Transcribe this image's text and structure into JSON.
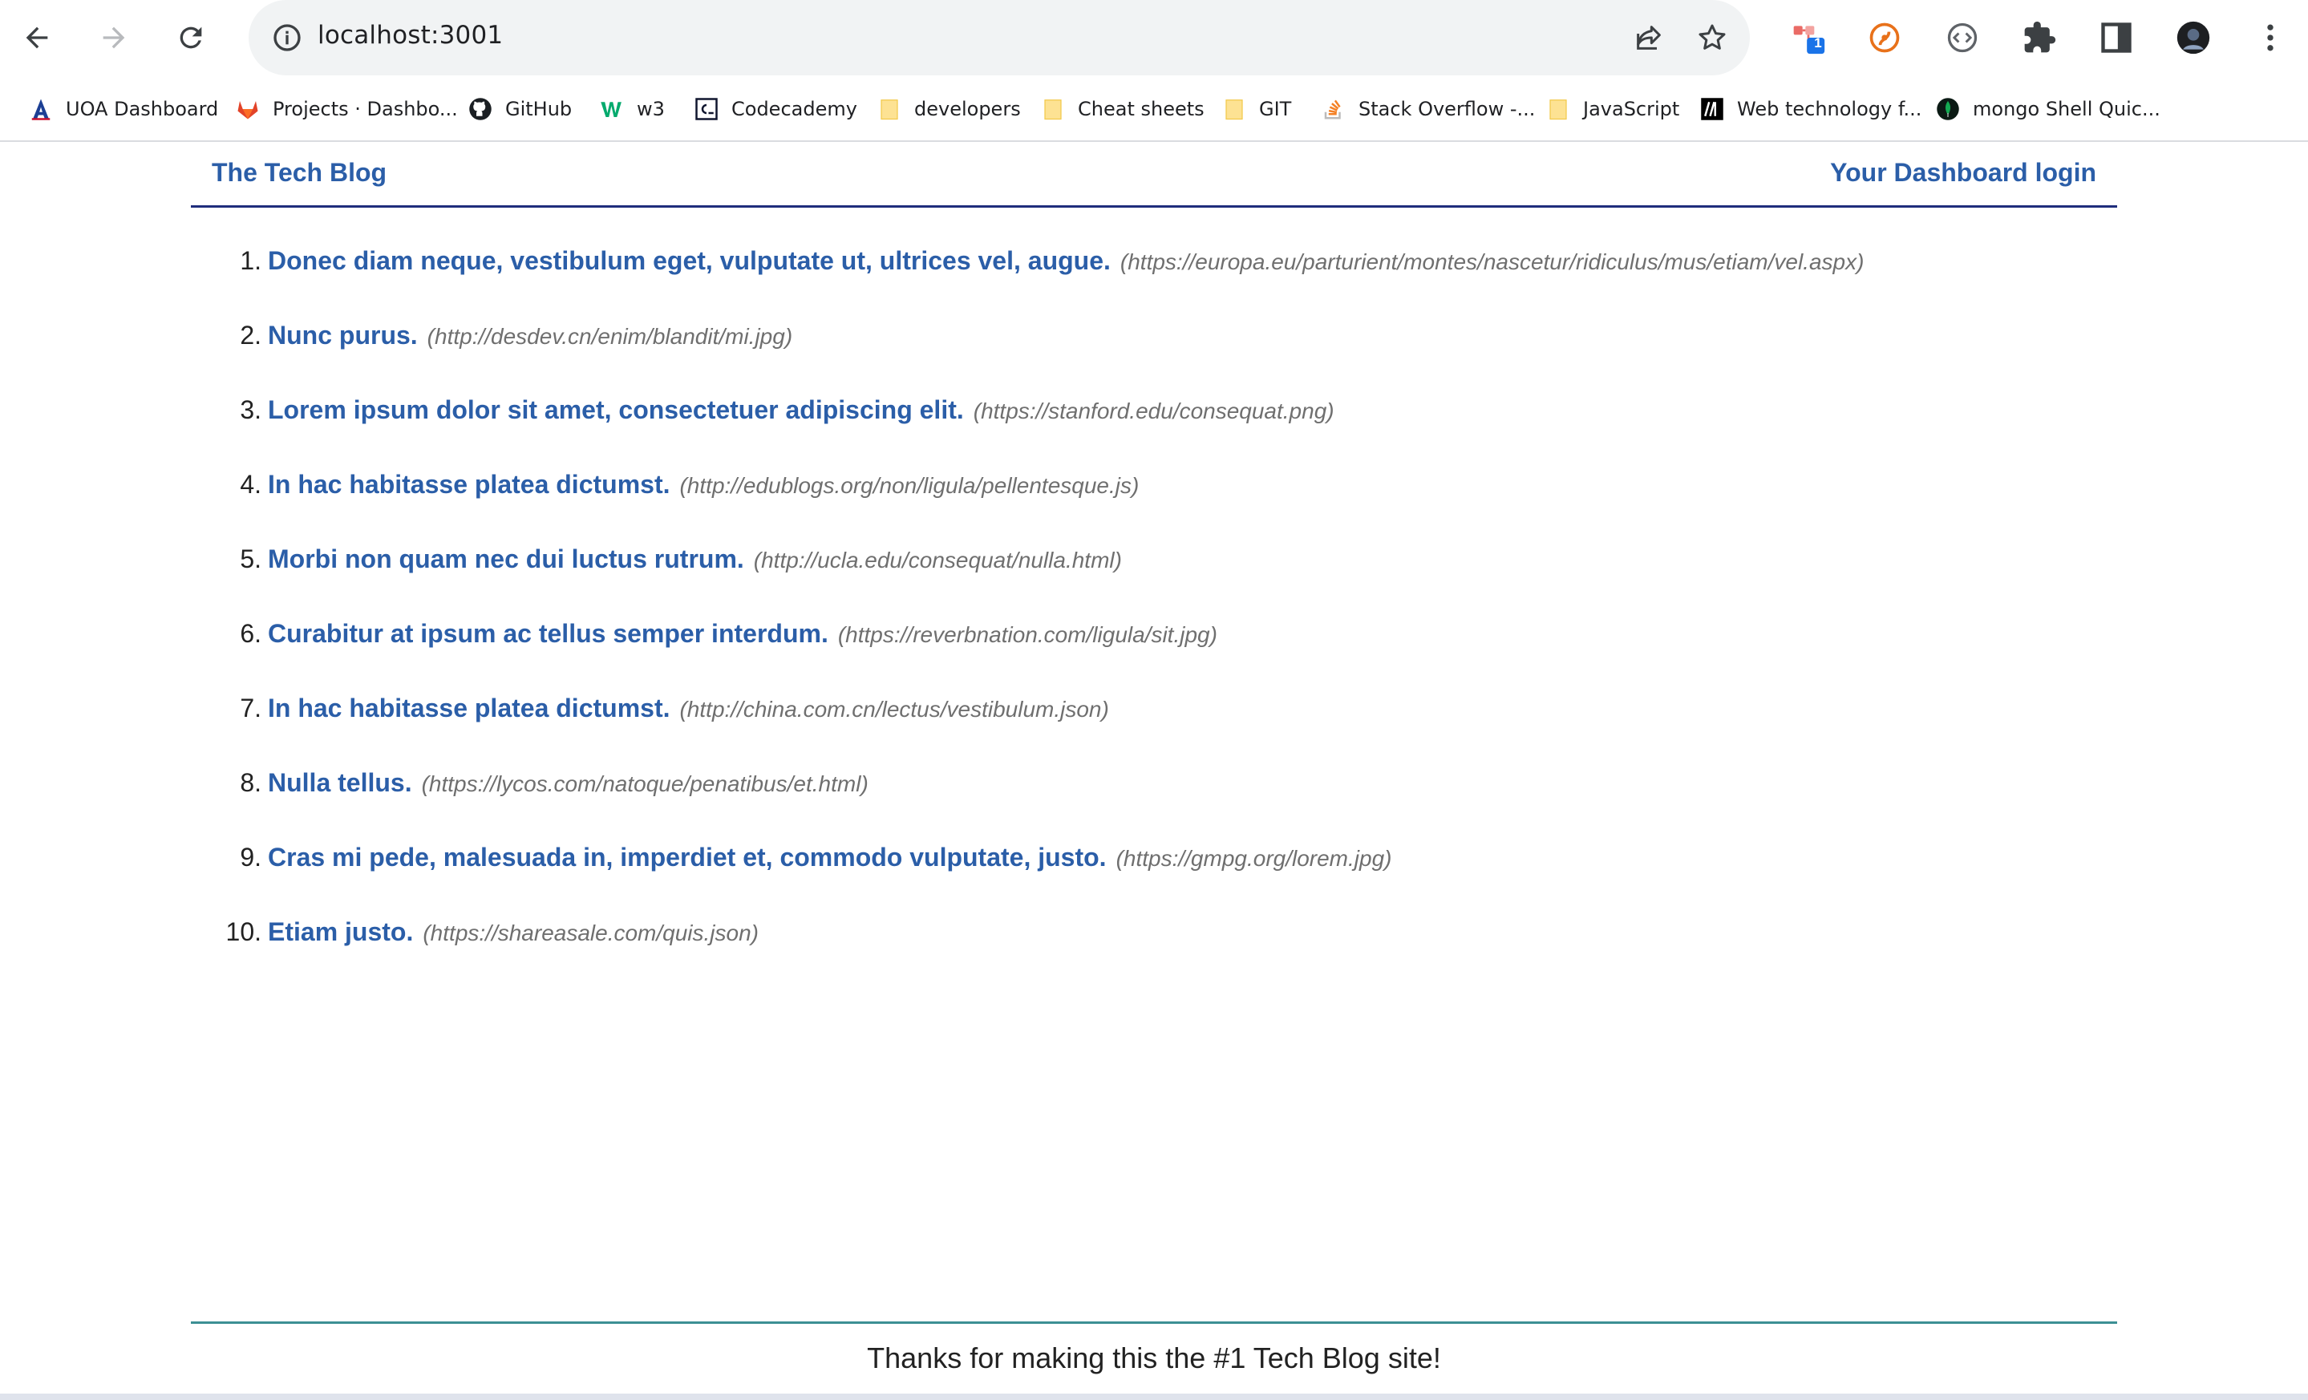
{
  "browser": {
    "url": "localhost:3001",
    "bookmarks": [
      {
        "label": "UOA Dashboard",
        "icon": "uoa-a-icon"
      },
      {
        "label": "Projects · Dashbo...",
        "icon": "gitlab-icon"
      },
      {
        "label": "GitHub",
        "icon": "github-icon"
      },
      {
        "label": "w3",
        "icon": "w3schools-icon"
      },
      {
        "label": "Codecademy",
        "icon": "codecademy-icon"
      },
      {
        "label": "developers",
        "icon": "folder-icon"
      },
      {
        "label": "Cheat sheets",
        "icon": "folder-icon"
      },
      {
        "label": "GIT",
        "icon": "folder-icon"
      },
      {
        "label": "Stack Overflow -...",
        "icon": "stackoverflow-icon"
      },
      {
        "label": "JavaScript",
        "icon": "folder-icon"
      },
      {
        "label": "Web technology f...",
        "icon": "mdn-icon"
      },
      {
        "label": "mongo Shell Quic...",
        "icon": "mongodb-leaf-icon"
      }
    ],
    "extension_badge": "1"
  },
  "header": {
    "brand": "The Tech Blog",
    "login": "Your Dashboard login"
  },
  "posts": [
    {
      "num": "1.",
      "title": "Donec diam neque, vestibulum eget, vulputate ut, ultrices vel, augue.",
      "link": "(https://europa.eu/parturient/montes/nascetur/ridiculus/mus/etiam/vel.aspx)"
    },
    {
      "num": "2.",
      "title": "Nunc purus.",
      "link": "(http://desdev.cn/enim/blandit/mi.jpg)"
    },
    {
      "num": "3.",
      "title": "Lorem ipsum dolor sit amet, consectetuer adipiscing elit.",
      "link": "(https://stanford.edu/consequat.png)"
    },
    {
      "num": "4.",
      "title": "In hac habitasse platea dictumst.",
      "link": "(http://edublogs.org/non/ligula/pellentesque.js)"
    },
    {
      "num": "5.",
      "title": "Morbi non quam nec dui luctus rutrum.",
      "link": "(http://ucla.edu/consequat/nulla.html)"
    },
    {
      "num": "6.",
      "title": "Curabitur at ipsum ac tellus semper interdum.",
      "link": "(https://reverbnation.com/ligula/sit.jpg)"
    },
    {
      "num": "7.",
      "title": "In hac habitasse platea dictumst.",
      "link": "(http://china.com.cn/lectus/vestibulum.json)"
    },
    {
      "num": "8.",
      "title": "Nulla tellus.",
      "link": "(https://lycos.com/natoque/penatibus/et.html)"
    },
    {
      "num": "9.",
      "title": "Cras mi pede, malesuada in, imperdiet et, commodo vulputate, justo.",
      "link": "(https://gmpg.org/lorem.jpg)"
    },
    {
      "num": "10.",
      "title": "Etiam justo.",
      "link": "(https://shareasale.com/quis.json)"
    }
  ],
  "footer": {
    "text": "Thanks for making this the #1 Tech Blog site!"
  }
}
